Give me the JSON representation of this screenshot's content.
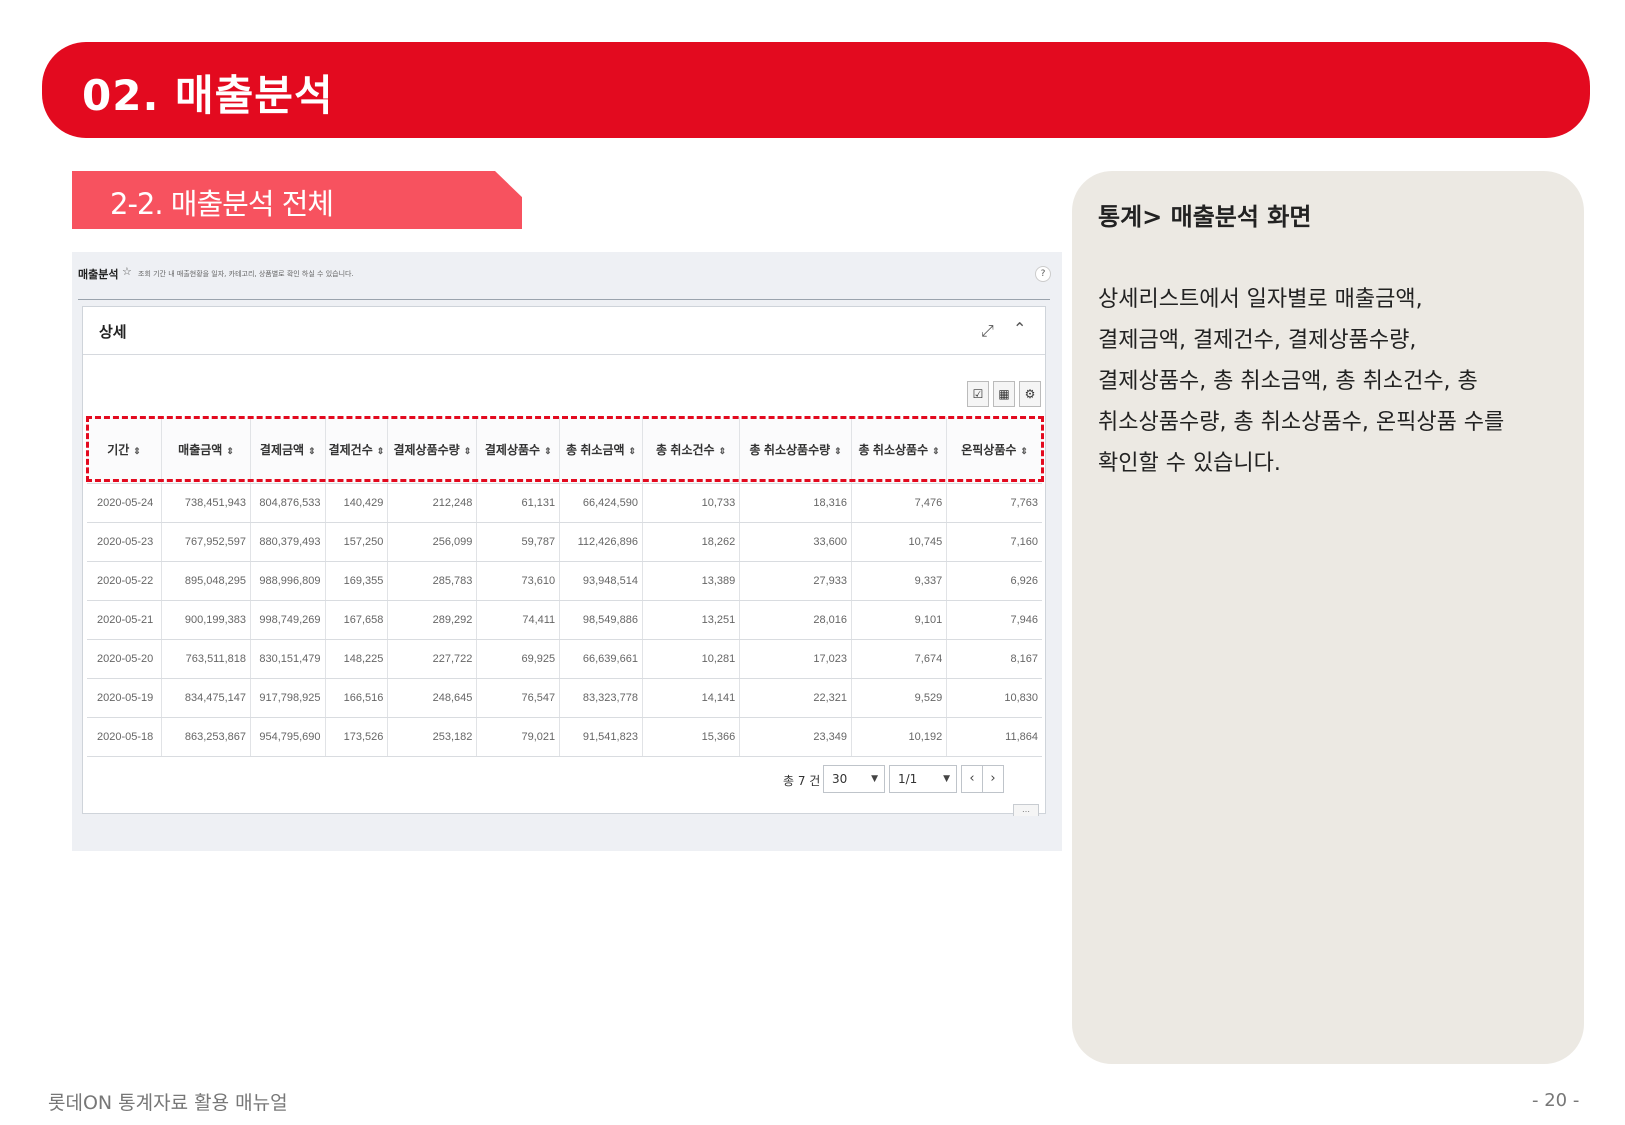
{
  "banner": {
    "title": "02. 매출분석"
  },
  "section": {
    "label": "2-2. 매출분석 전체"
  },
  "screen": {
    "title": "매출분석",
    "description": "조회 기간 내 매출현황을 일자, 카테고리, 상품별로 확인 하실 수 있습니다.",
    "help": "?",
    "card_title": "상세",
    "table": {
      "headers": [
        "기간",
        "매출금액",
        "결제금액",
        "결제건수",
        "결제상품수량",
        "결제상품수",
        "총 취소금액",
        "총 취소건수",
        "총 취소상품수량",
        "총 취소상품수",
        "온픽상품수"
      ],
      "rows": [
        [
          "2020-05-24",
          "738,451,943",
          "804,876,533",
          "140,429",
          "212,248",
          "61,131",
          "66,424,590",
          "10,733",
          "18,316",
          "7,476",
          "7,763"
        ],
        [
          "2020-05-23",
          "767,952,597",
          "880,379,493",
          "157,250",
          "256,099",
          "59,787",
          "112,426,896",
          "18,262",
          "33,600",
          "10,745",
          "7,160"
        ],
        [
          "2020-05-22",
          "895,048,295",
          "988,996,809",
          "169,355",
          "285,783",
          "73,610",
          "93,948,514",
          "13,389",
          "27,933",
          "9,337",
          "6,926"
        ],
        [
          "2020-05-21",
          "900,199,383",
          "998,749,269",
          "167,658",
          "289,292",
          "74,411",
          "98,549,886",
          "13,251",
          "28,016",
          "9,101",
          "7,946"
        ],
        [
          "2020-05-20",
          "763,511,818",
          "830,151,479",
          "148,225",
          "227,722",
          "69,925",
          "66,639,661",
          "10,281",
          "17,023",
          "7,674",
          "8,167"
        ],
        [
          "2020-05-19",
          "834,475,147",
          "917,798,925",
          "166,516",
          "248,645",
          "76,547",
          "83,323,778",
          "14,141",
          "22,321",
          "9,529",
          "10,830"
        ],
        [
          "2020-05-18",
          "863,253,867",
          "954,795,690",
          "173,526",
          "253,182",
          "79,021",
          "91,541,823",
          "15,366",
          "23,349",
          "10,192",
          "11,864"
        ]
      ]
    },
    "pager": {
      "total": "총 7 건",
      "page_size": "30",
      "page": "1/1"
    }
  },
  "desc": {
    "title": "통계> 매출분석 화면",
    "lines": [
      "상세리스트에서 일자별로 매출금액,",
      "결제금액, 결제건수, 결제상품수량,",
      "결제상품수, 총 취소금액, 총 취소건수, 총",
      "취소상품수량, 총 취소상품수, 온픽상품 수를",
      "확인할 수 있습니다."
    ]
  },
  "footer": {
    "left": "롯데ON 통계자료 활용 매뉴얼",
    "page": "- 20 -"
  },
  "colors": {
    "brand_red": "#e30a1f",
    "section_tab": "#f7525f",
    "desc_panel": "#ece9e3"
  }
}
